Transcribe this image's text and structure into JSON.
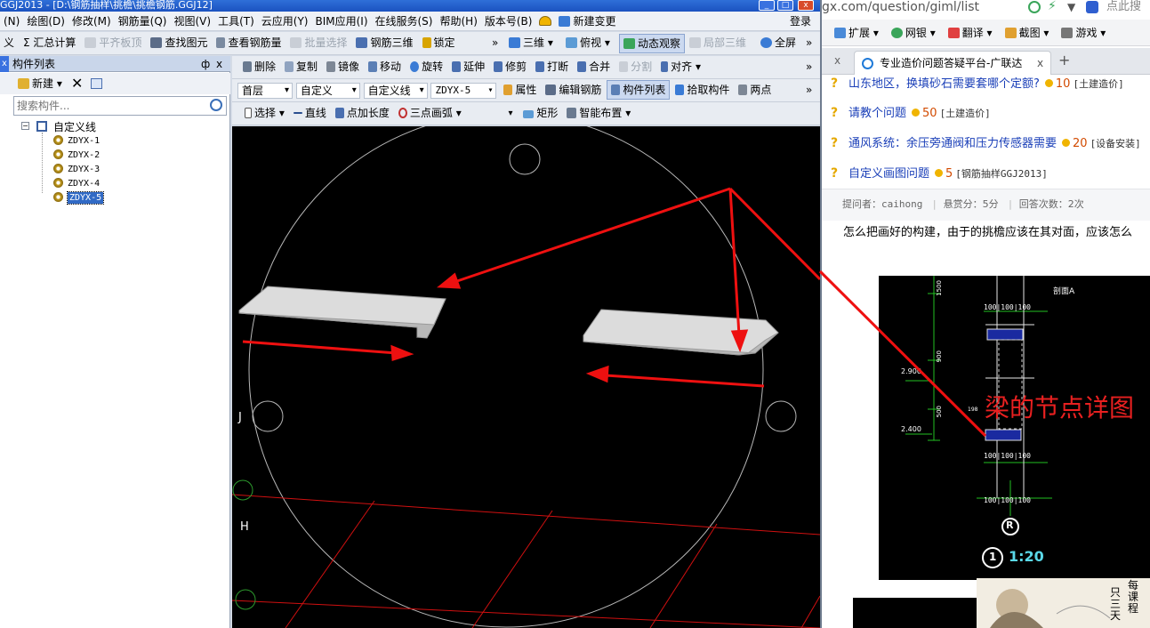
{
  "app": {
    "title": "GGJ2013 - [D:\\钢筋抽样\\挑檐\\挑檐钢筋.GGJ12]",
    "window_buttons": [
      "_",
      "□",
      "x"
    ],
    "menu": [
      "(N)",
      "绘图(D)",
      "修改(M)",
      "钢筋量(Q)",
      "视图(V)",
      "工具(T)",
      "云应用(Y)",
      "BIM应用(I)",
      "在线服务(S)",
      "帮助(H)",
      "版本号(B)",
      "新建变更",
      "登录"
    ],
    "toolbar1": {
      "items": [
        "义",
        "Σ 汇总计算",
        "平齐板顶",
        "查找图元",
        "查看钢筋量",
        "批量选择",
        "钢筋三维",
        "锁定"
      ],
      "overflow": "»",
      "view3d": "三维",
      "view_top": "俯视",
      "dynamic": "动态观察",
      "local3d": "局部三维",
      "fullscreen": "全屏"
    },
    "toolbar2": {
      "items": [
        "删除",
        "复制",
        "镜像",
        "移动",
        "旋转",
        "延伸",
        "修剪",
        "打断",
        "合并",
        "分割",
        "对齐"
      ],
      "overflow": "»"
    },
    "toolbar3": {
      "floor": "首层",
      "category": "自定义",
      "type": "自定义线",
      "element": "ZDYX-5",
      "items": [
        "属性",
        "编辑钢筋",
        "构件列表",
        "拾取构件",
        "两点"
      ],
      "overflow": "»"
    },
    "toolbar4": {
      "items": [
        "选择",
        "直线",
        "点加长度",
        "三点画弧",
        "矩形",
        "智能布置"
      ],
      "blank_select": ""
    },
    "left_panel": {
      "title": "构件列表",
      "pin": "ф",
      "close": "x",
      "new_button": "新建",
      "search_placeholder": "搜索构件...",
      "tree_root": "自定义线",
      "tree_items": [
        "ZDYX-1",
        "ZDYX-2",
        "ZDYX-3",
        "ZDYX-4",
        "ZDYX-5"
      ],
      "selected_item": "ZDYX-5",
      "edge_marker": "x"
    },
    "canvas": {
      "axis_labels": [
        "J",
        "H"
      ]
    }
  },
  "browser": {
    "address": "gx.com/question/giml/list",
    "search_hint": "点此搜",
    "toolbar": [
      "扩展",
      "网银",
      "翻译",
      "截图",
      "游戏"
    ],
    "tab_close_left": "x",
    "tab_title": "专业造价问题答疑平台-广联达",
    "tab_close": "x",
    "new_tab": "+",
    "questions": [
      {
        "title": "山东地区，换填砂石需要套哪个定额?",
        "reward": "10",
        "tag": "[土建造价]"
      },
      {
        "title": "请教个问题",
        "reward": "50",
        "tag": "[土建造价]"
      },
      {
        "title": "通风系统：余压旁通阀和压力传感器需要",
        "reward": "20",
        "tag": "[设备安装]"
      },
      {
        "title": "自定义画图问题",
        "reward": "5",
        "tag": "[钢筋抽样GGJ2013]"
      }
    ],
    "meta": {
      "asker_label": "提问者：",
      "asker": "caihong",
      "bounty": "悬赏分：5分",
      "answers": "回答次数：2次"
    },
    "question_body": "怎么把画好的构建，由于的挑檐应该在其对面，应该怎么",
    "drawing": {
      "title": "剖面A",
      "dims_top": "100|100|100",
      "dims_bottom": "100|100|100",
      "elevations": [
        "2.900",
        "2.400"
      ],
      "left_dims": [
        "1500",
        "900",
        "500"
      ],
      "annotation": "梁的节点详图",
      "axis": "R",
      "scale_no": "1",
      "scale": "1:20",
      "small": [
        "100",
        "100",
        "150",
        "100",
        "100",
        "198"
      ]
    },
    "ad_text": [
      "每",
      "课",
      "程",
      "只",
      "三",
      "天"
    ]
  },
  "colors": {
    "arrow_red": "#e81010",
    "link_blue": "#1a3fb8",
    "menu_bg": "#eef1f6",
    "selection": "#316ac5"
  }
}
